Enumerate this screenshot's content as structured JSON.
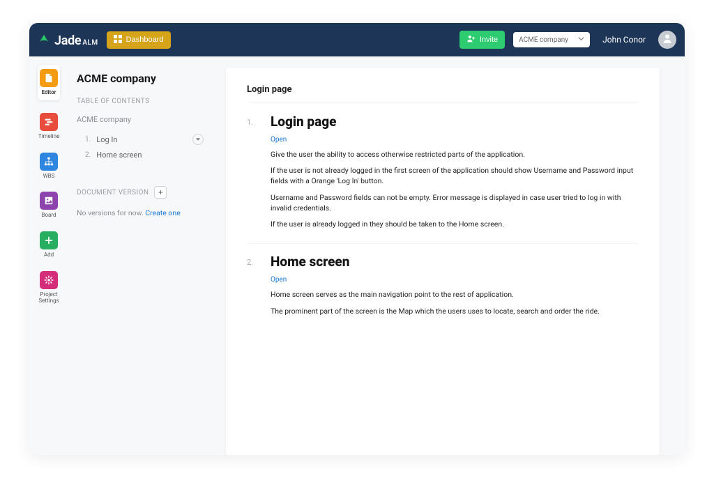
{
  "brand": {
    "main": "Jade",
    "sub": "ALM"
  },
  "topbar": {
    "dashboard_label": "Dashboard",
    "invite_label": "Invite",
    "company_selected": "ACME company",
    "user_name": "John Conor"
  },
  "rail": [
    {
      "label": "Editor",
      "color": "#f39c12"
    },
    {
      "label": "Timeline",
      "color": "#e74c3c"
    },
    {
      "label": "WBS",
      "color": "#2e86de"
    },
    {
      "label": "Board",
      "color": "#8e44ad"
    },
    {
      "label": "Add",
      "color": "#27ae60"
    },
    {
      "label": "Project Settings",
      "color": "#d42e7b"
    }
  ],
  "toc": {
    "title": "ACME company",
    "header": "TABLE OF CONTENTS",
    "company": "ACME company",
    "items": [
      {
        "index": "1.",
        "label": "Log In"
      },
      {
        "index": "2.",
        "label": "Home screen"
      }
    ],
    "docver_label": "DOCUMENT VERSION",
    "noversions_prefix": "No versions for now. ",
    "noversions_link": "Create one"
  },
  "content": {
    "card_title": "Login page",
    "open_label": "Open",
    "sections": [
      {
        "num": "1.",
        "heading": "Login page",
        "paras": [
          "Give the user the ability to access otherwise restricted parts of the application.",
          "If the user is not already logged in the first screen of the application should show Username and Password input fields with a Orange 'Log In' button.",
          "Username and Password fields can not be empty. Error message is displayed in case user tried to log in with invalid credentials.",
          "If the user is already logged in they should be taken to the Home screen."
        ]
      },
      {
        "num": "2.",
        "heading": "Home screen",
        "paras": [
          "Home screen serves as the main navigation point to the rest of application.",
          "The prominent part of the screen is the Map which the users uses to locate, search and order the ride."
        ]
      }
    ]
  }
}
